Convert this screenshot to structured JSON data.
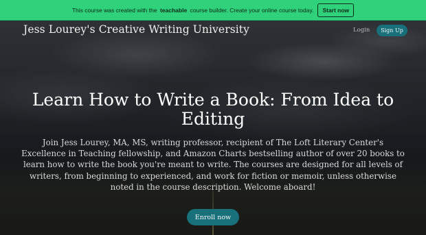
{
  "promo": {
    "text_before": "This course was created with the",
    "brand": "teachable",
    "text_after": "course builder. Create your online course today.",
    "cta_label": "Start now",
    "color": "#2fd27a"
  },
  "header": {
    "site_title": "Jess Lourey's Creative Writing University",
    "login_label": "Login",
    "signup_label": "Sign Up"
  },
  "hero": {
    "headline": "Learn How to Write a Book: From Idea to Editing",
    "description": "Join Jess Lourey, MA, MS, writing professor, recipient of The Loft Literary Center's Excellence in Teaching fellowship, and Amazon Charts bestselling author of over 20 books to learn how to write the book you're meant to write. The courses are designed for all levels of writers, from beginning to experienced, and work for fiction or memoir, unless otherwise noted in the course description. Welcome aboard!",
    "enroll_label": "Enroll now"
  },
  "colors": {
    "accent": "#17707a"
  }
}
